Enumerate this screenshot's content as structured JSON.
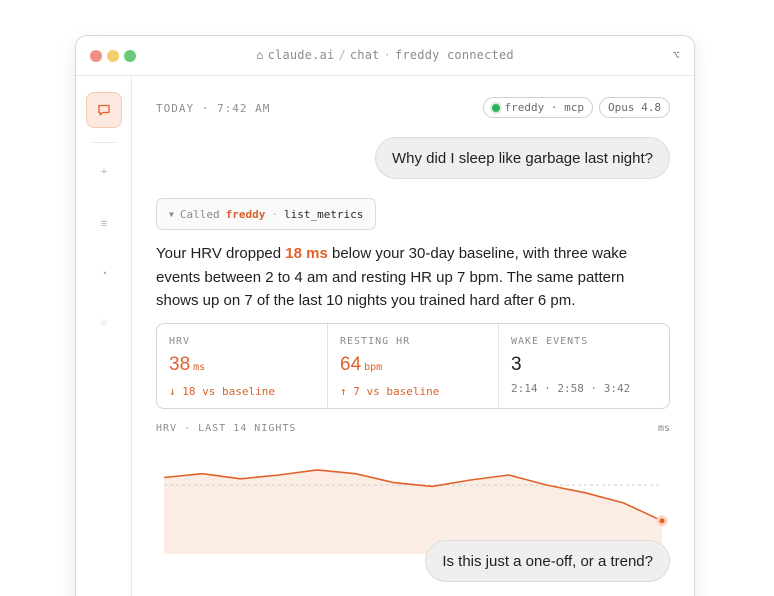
{
  "window": {
    "title_host": "claude.ai",
    "title_sep": "/",
    "title_path": "chat",
    "title_sep2": "·",
    "title_status": "freddy connected",
    "title_right_icon": "⌥"
  },
  "header": {
    "timestamp": "TODAY · 7:42 AM",
    "connector_pill": "freddy · mcp",
    "model_pill": "Opus 4.8",
    "connector_status_color": "#2fb35c"
  },
  "sidebar": {
    "items": [
      {
        "icon": "chat-icon",
        "active": true
      },
      {
        "icon": "plus-icon"
      },
      {
        "icon": "list-icon"
      },
      {
        "icon": "clock-icon"
      },
      {
        "icon": "star-icon"
      }
    ]
  },
  "conversation": {
    "user_message_1": "Why did I sleep like garbage last night?",
    "tool_call": {
      "prefix": "Called",
      "server": "freddy",
      "separator": "·",
      "function": "list_metrics"
    },
    "answer": {
      "part1": "Your HRV dropped ",
      "highlight": "18 ms",
      "part2": " below your 30-day baseline, with three wake events between 2 to 4 am and resting HR up 7 bpm. The same pattern shows up on 7 of the last 10 nights you trained hard after 6 pm."
    },
    "metrics": [
      {
        "label": "HRV",
        "value": "38",
        "unit": "ms",
        "delta": "↓ 18 vs baseline"
      },
      {
        "label": "RESTING HR",
        "value": "64",
        "unit": "bpm",
        "delta": "↑ 7 vs baseline"
      },
      {
        "label": "WAKE EVENTS",
        "value": "3",
        "unit": "",
        "delta": "2:14 · 2:58 · 3:42"
      }
    ],
    "user_message_2": "Is this just a one-off, or a trend?"
  },
  "chart_data": {
    "type": "area",
    "title": "HRV · LAST 14 NIGHTS",
    "unit_label": "ms",
    "x": [
      1,
      2,
      3,
      4,
      5,
      6,
      7,
      8,
      9,
      10,
      11,
      12,
      13,
      14
    ],
    "values": [
      55,
      56.5,
      54.5,
      56,
      58,
      56.5,
      53,
      51.5,
      54,
      56,
      52,
      49,
      45,
      38
    ],
    "baseline": 52,
    "ylim": [
      25,
      65
    ],
    "colors": {
      "line": "#e0622a",
      "fill": "#fbe5d9",
      "baseline": "#cfcfcf"
    }
  },
  "accent_color": "#e0622a"
}
